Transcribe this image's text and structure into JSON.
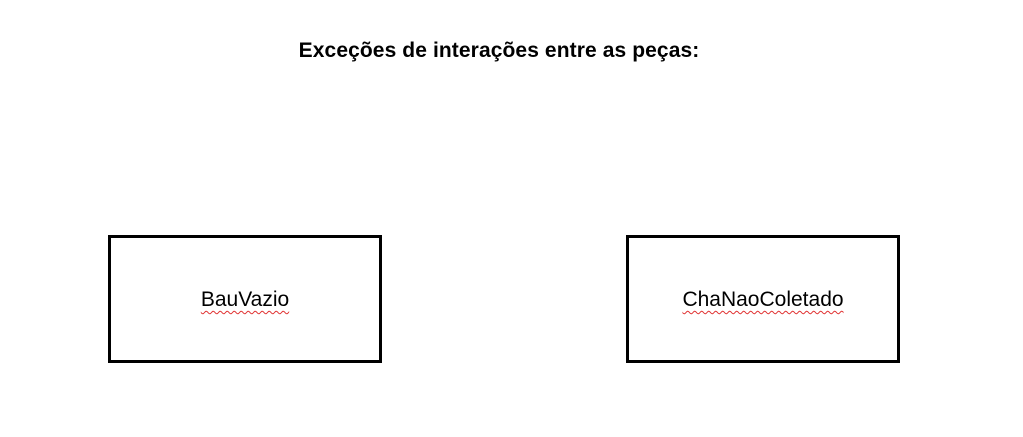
{
  "diagram": {
    "title": "Exceções de interações entre as peças:",
    "boxes": [
      {
        "label": "BauVazio"
      },
      {
        "label": "ChaNaoColetado"
      }
    ]
  },
  "colors": {
    "border": "#000000",
    "spellcheck_underline": "#e03030",
    "background": "#ffffff"
  }
}
